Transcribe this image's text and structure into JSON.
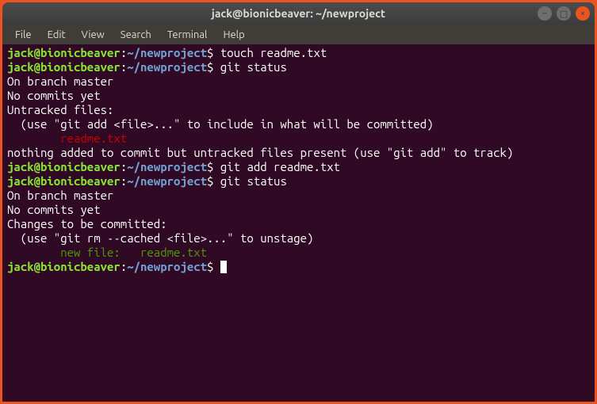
{
  "titlebar": {
    "title": "jack@bionicbeaver: ~/newproject"
  },
  "menubar": {
    "items": [
      "File",
      "Edit",
      "View",
      "Search",
      "Terminal",
      "Help"
    ]
  },
  "prompt": {
    "user_host": "jack@bionicbeaver",
    "colon": ":",
    "path": "~/newproject",
    "dollar": "$"
  },
  "commands": {
    "cmd1": " touch readme.txt",
    "cmd2": " git status",
    "cmd3": " git add readme.txt",
    "cmd4": " git status",
    "cmd5": " "
  },
  "output": {
    "branch": "On branch master",
    "blank": "",
    "nocommits": "No commits yet",
    "untracked_hdr": "Untracked files:",
    "untracked_hint": "  (use \"git add <file>...\" to include in what will be committed)",
    "untracked_file": "\treadme.txt",
    "nothing_added": "nothing added to commit but untracked files present (use \"git add\" to track)",
    "changes_hdr": "Changes to be committed:",
    "changes_hint": "  (use \"git rm --cached <file>...\" to unstage)",
    "new_file": "\tnew file:   readme.txt"
  }
}
